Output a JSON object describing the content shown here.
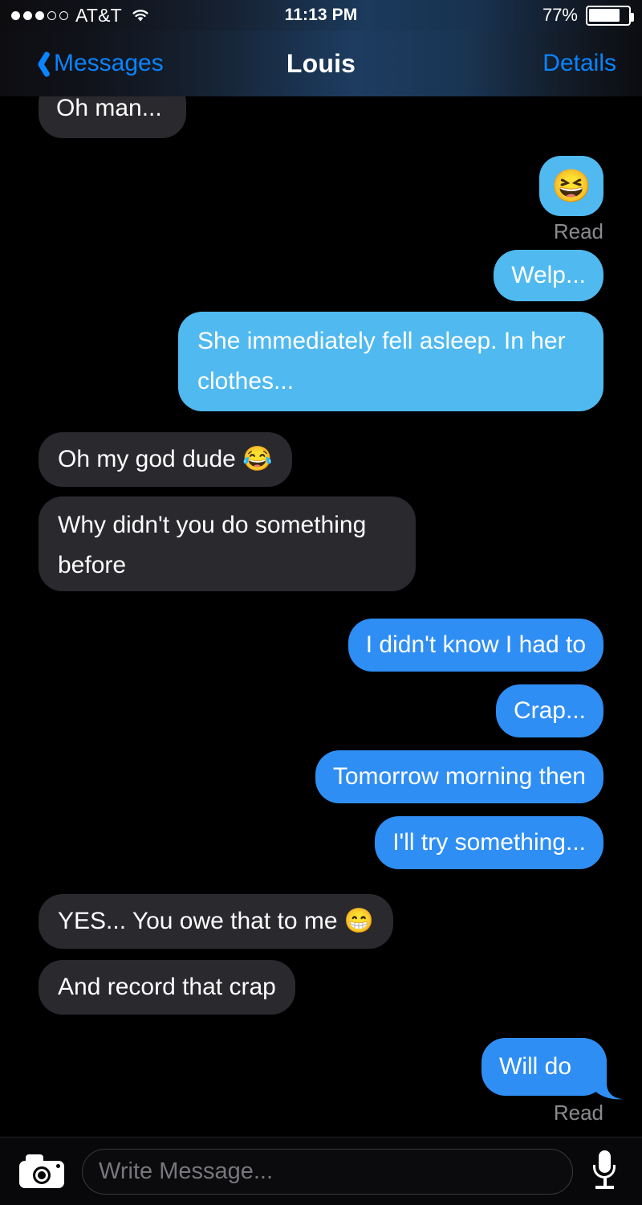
{
  "status_bar": {
    "carrier": "AT&T",
    "signal_bars_filled": 3,
    "signal_bars_total": 5,
    "wifi_icon": "wifi-icon",
    "time": "11:13 PM",
    "battery_percent": "77%",
    "battery_level": 77
  },
  "nav_bar": {
    "back_icon": "chevron-left-icon",
    "back_label": "Messages",
    "title": "Louis",
    "details_label": "Details"
  },
  "colors": {
    "outgoing_light": "#50b9ef",
    "outgoing_blue": "#2f8ef4",
    "incoming": "#29292e",
    "accent": "#0a84ff",
    "read_text": "#8a8a8f",
    "background": "#000000"
  },
  "messages": [
    {
      "id": "m1",
      "side": "incoming",
      "style": "incoming",
      "text": "Oh man...",
      "clipped": true
    },
    {
      "id": "m2",
      "side": "outgoing",
      "style": "outgoing_light",
      "text": "😆",
      "is_emoji": true,
      "status": "Read"
    },
    {
      "id": "m3",
      "side": "outgoing",
      "style": "outgoing_light",
      "text": "Welp..."
    },
    {
      "id": "m4",
      "side": "outgoing",
      "style": "outgoing_light",
      "text": "She immediately fell asleep. In her clothes..."
    },
    {
      "id": "m5",
      "side": "incoming",
      "style": "incoming",
      "text": "Oh my god dude 😂"
    },
    {
      "id": "m6",
      "side": "incoming",
      "style": "incoming",
      "text": "Why didn't you do something before"
    },
    {
      "id": "m7",
      "side": "outgoing",
      "style": "outgoing_blue",
      "text": "I didn't know I had to"
    },
    {
      "id": "m8",
      "side": "outgoing",
      "style": "outgoing_blue",
      "text": "Crap..."
    },
    {
      "id": "m9",
      "side": "outgoing",
      "style": "outgoing_blue",
      "text": "Tomorrow morning then"
    },
    {
      "id": "m10",
      "side": "outgoing",
      "style": "outgoing_blue",
      "text": "I'll try something..."
    },
    {
      "id": "m11",
      "side": "incoming",
      "style": "incoming",
      "text": "YES... You owe that to me 😁"
    },
    {
      "id": "m12",
      "side": "incoming",
      "style": "incoming",
      "text": "And record that crap"
    },
    {
      "id": "m13",
      "side": "outgoing",
      "style": "outgoing_blue",
      "text": "Will do",
      "has_tail": true,
      "status": "Read"
    }
  ],
  "read_receipts": {
    "first": "Read",
    "last": "Read"
  },
  "input_bar": {
    "camera_icon": "camera-icon",
    "placeholder": "Write Message...",
    "value": "",
    "mic_icon": "microphone-icon"
  }
}
